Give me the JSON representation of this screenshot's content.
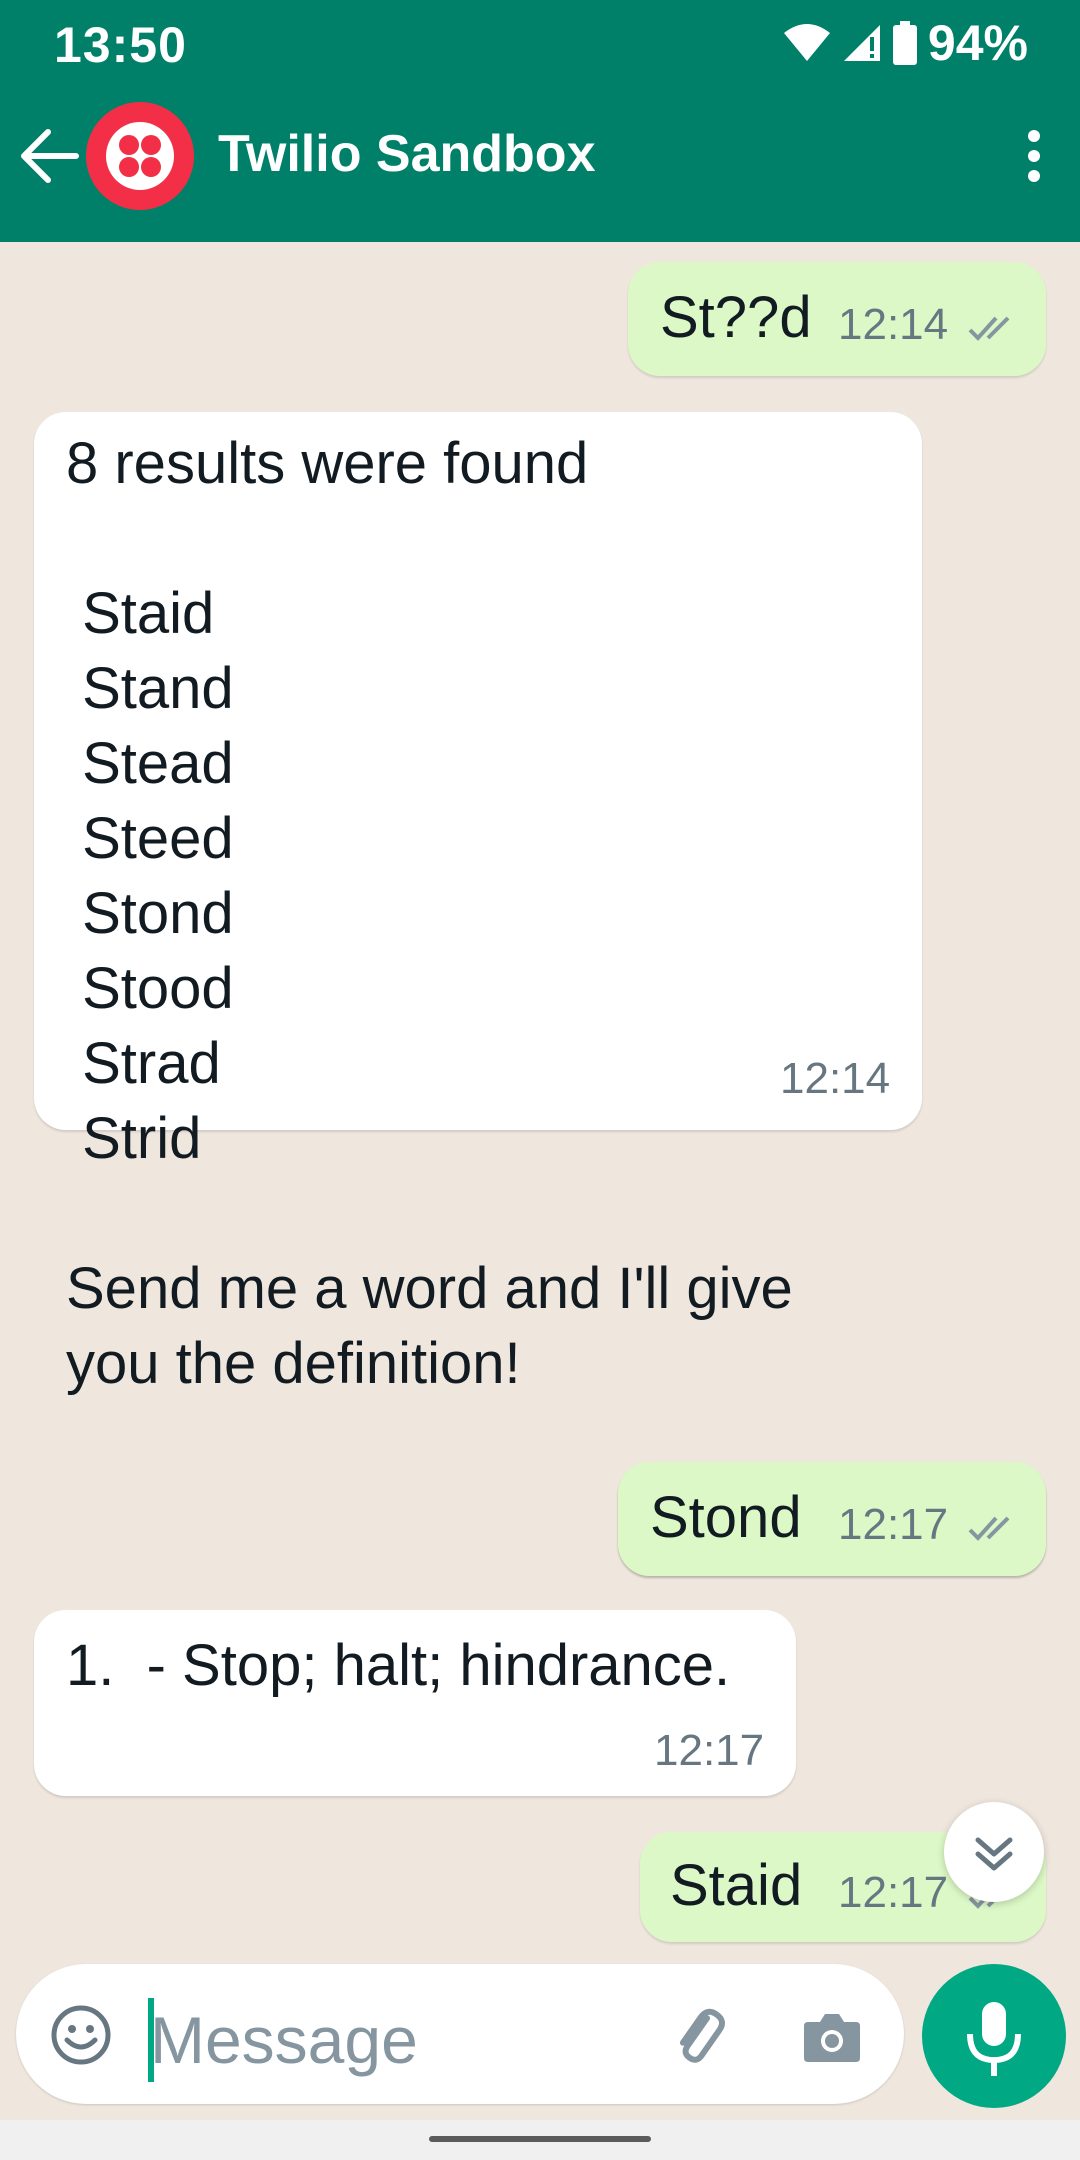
{
  "status_bar": {
    "time": "13:50",
    "battery": "94%"
  },
  "header": {
    "title": "Twilio Sandbox"
  },
  "messages": [
    {
      "direction": "out",
      "text": "St??d",
      "time": "12:14"
    },
    {
      "direction": "in",
      "text": "8 results were found\n\n Staid\n Stand\n Stead\n Steed\n Stond\n Stood\n Strad\n Strid\n\nSend me a word and I'll give\nyou the definition!",
      "time": "12:14"
    },
    {
      "direction": "out",
      "text": "Stond",
      "time": "12:17"
    },
    {
      "direction": "in",
      "text": "1.  - Stop; halt; hindrance.",
      "time": "12:17"
    },
    {
      "direction": "out",
      "text": "Staid",
      "time": "12:17"
    }
  ],
  "composer": {
    "placeholder": "Message"
  },
  "icons": [
    "back-arrow-icon",
    "twilio-logo-icon",
    "more-vert-icon",
    "wifi-icon",
    "signal-icon",
    "battery-icon",
    "double-check-icon",
    "scroll-down-icon",
    "emoji-icon",
    "attach-icon",
    "camera-icon",
    "mic-icon"
  ],
  "colors": {
    "header": "#008069",
    "outgoing": "#dcf8c6",
    "incoming": "#ffffff",
    "accent": "#00a884"
  }
}
